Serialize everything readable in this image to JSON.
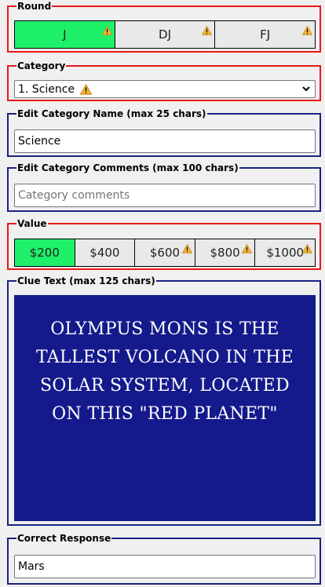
{
  "round": {
    "legend": "Round",
    "options": [
      {
        "label": "J",
        "active": true,
        "warning": true
      },
      {
        "label": "DJ",
        "active": false,
        "warning": true
      },
      {
        "label": "FJ",
        "active": false,
        "warning": true
      }
    ]
  },
  "category": {
    "legend": "Category",
    "selected": "1. Science",
    "warning": true
  },
  "edit_name": {
    "legend": "Edit Category Name (max 25 chars)",
    "value": "Science"
  },
  "edit_comments": {
    "legend": "Edit Category Comments (max 100 chars)",
    "placeholder": "Category comments"
  },
  "value": {
    "legend": "Value",
    "options": [
      {
        "label": "$200",
        "active": true,
        "warning": false
      },
      {
        "label": "$400",
        "active": false,
        "warning": false
      },
      {
        "label": "$600",
        "active": false,
        "warning": true
      },
      {
        "label": "$800",
        "active": false,
        "warning": true
      },
      {
        "label": "$1000",
        "active": false,
        "warning": true
      }
    ]
  },
  "clue": {
    "legend": "Clue Text (max 125 chars)",
    "text": "Olympus Mons is the tallest volcano in the solar system, located on this \"Red Planet\""
  },
  "response": {
    "legend": "Correct Response",
    "value": "Mars"
  },
  "colors": {
    "active": "#1ef06a",
    "board": "#141a8b",
    "required_border": "#e81818",
    "optional_border": "#1a237e"
  }
}
